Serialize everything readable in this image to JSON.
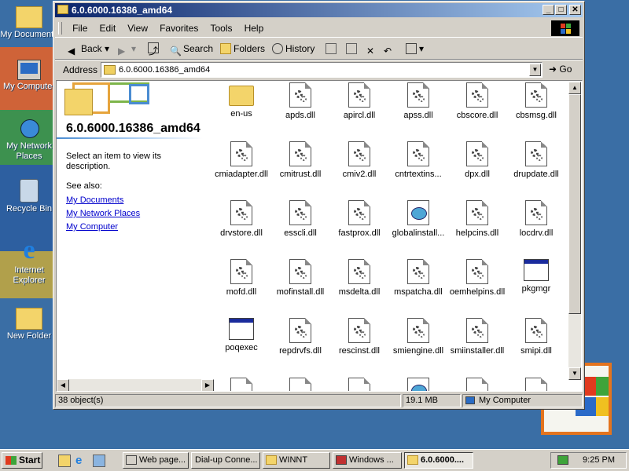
{
  "desktop": {
    "icons": [
      {
        "label": "My Documents"
      },
      {
        "label": "My Computer"
      },
      {
        "label": "My Network Places"
      },
      {
        "label": "Recycle Bin"
      },
      {
        "label": "Internet Explorer"
      },
      {
        "label": "New Folder"
      }
    ]
  },
  "window": {
    "title": "6.0.6000.16386_amd64",
    "menu": [
      "File",
      "Edit",
      "View",
      "Favorites",
      "Tools",
      "Help"
    ],
    "toolbar": {
      "back": "Back",
      "search": "Search",
      "folders": "Folders",
      "history": "History"
    },
    "address": {
      "label": "Address",
      "value": "6.0.6000.16386_amd64",
      "go": "Go"
    },
    "leftpane": {
      "title": "6.0.6000.16386_amd64",
      "description": "Select an item to view its description.",
      "see_also": "See also:",
      "links": [
        "My Documents",
        "My Network Places",
        "My Computer"
      ]
    },
    "files": [
      {
        "name": "en-us",
        "type": "folder"
      },
      {
        "name": "apds.dll",
        "type": "dll"
      },
      {
        "name": "apircl.dll",
        "type": "dll"
      },
      {
        "name": "apss.dll",
        "type": "dll"
      },
      {
        "name": "cbscore.dll",
        "type": "dll"
      },
      {
        "name": "cbsmsg.dll",
        "type": "dll"
      },
      {
        "name": "cmiadapter.dll",
        "type": "dll"
      },
      {
        "name": "cmitrust.dll",
        "type": "dll"
      },
      {
        "name": "cmiv2.dll",
        "type": "dll"
      },
      {
        "name": "cntrtextins...",
        "type": "dll"
      },
      {
        "name": "dpx.dll",
        "type": "dll"
      },
      {
        "name": "drupdate.dll",
        "type": "dll"
      },
      {
        "name": "drvstore.dll",
        "type": "dll"
      },
      {
        "name": "esscli.dll",
        "type": "dll"
      },
      {
        "name": "fastprox.dll",
        "type": "dll"
      },
      {
        "name": "globalinstall...",
        "type": "setup"
      },
      {
        "name": "helpcins.dll",
        "type": "dll"
      },
      {
        "name": "locdrv.dll",
        "type": "dll"
      },
      {
        "name": "mofd.dll",
        "type": "dll"
      },
      {
        "name": "mofinstall.dll",
        "type": "dll"
      },
      {
        "name": "msdelta.dll",
        "type": "dll"
      },
      {
        "name": "mspatcha.dll",
        "type": "dll"
      },
      {
        "name": "oemhelpins.dll",
        "type": "dll"
      },
      {
        "name": "pkgmgr",
        "type": "exe"
      },
      {
        "name": "poqexec",
        "type": "exe"
      },
      {
        "name": "repdrvfs.dll",
        "type": "dll"
      },
      {
        "name": "rescinst.dll",
        "type": "dll"
      },
      {
        "name": "smiengine.dll",
        "type": "dll"
      },
      {
        "name": "smiinstaller.dll",
        "type": "dll"
      },
      {
        "name": "smipi.dll",
        "type": "dll"
      }
    ],
    "status": {
      "objects": "38 object(s)",
      "size": "19.1 MB",
      "zone": "My Computer"
    }
  },
  "taskbar": {
    "start": "Start",
    "tasks": [
      "Web page...",
      "Dial-up Conne...",
      "WINNT",
      "Windows ...",
      "6.0.6000...."
    ],
    "clock": "9:25 PM"
  }
}
